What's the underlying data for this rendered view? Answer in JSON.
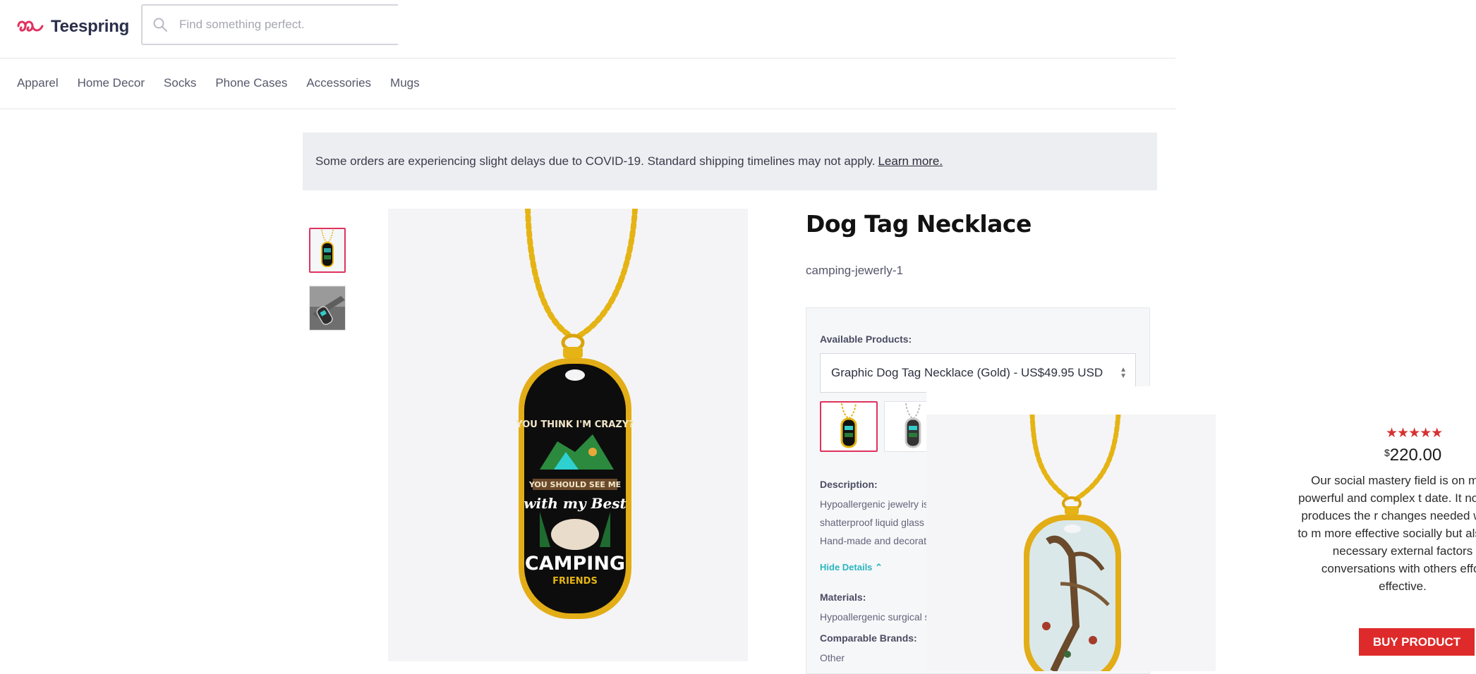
{
  "header": {
    "brand": "Teespring",
    "search": {
      "placeholder": "Find something perfect.",
      "value": ""
    }
  },
  "nav": {
    "items": [
      "Apparel",
      "Home Decor",
      "Socks",
      "Phone Cases",
      "Accessories",
      "Mugs"
    ]
  },
  "notice": {
    "text": "Some orders are experiencing slight delays due to COVID-19. Standard shipping timelines may not apply.",
    "link": "Learn more."
  },
  "product": {
    "title": "Dog Tag Necklace",
    "slug": "camping-jewerly-1",
    "available_label": "Available Products:",
    "selected_product": "Graphic Dog Tag Necklace (Gold) - US$49.95 USD",
    "description_label": "Description:",
    "description_lines": [
      "Hypoallergenic jewelry is r",
      "shatterproof liquid glass c",
      "Hand-made and decorat"
    ],
    "hide_details": "Hide Details",
    "materials_label": "Materials:",
    "materials_text": "Hypoallergenic surgical st",
    "brands_label": "Comparable Brands:",
    "brands_text": "Other",
    "tag_art_text": {
      "line1": "YOU THINK I'M CRAZY?",
      "line2": "YOU SHOULD SEE ME",
      "line3": "with my Best",
      "line4": "CAMPING",
      "line5": "FRIENDS"
    }
  },
  "side_offer": {
    "rating": "★★★★★",
    "currency": "$",
    "price": "220.00",
    "copy": "Our social mastery field is on most powerful and complex t date. It not only produces the r changes needed within to m more effective socially but also the necessary external factors conversations with others effor effective.",
    "button": "BUY PRODUCT"
  },
  "colors": {
    "accent": "#e0325f",
    "buy_button": "#de2a2a",
    "stars": "#d63232",
    "link_teal": "#2bb6c0",
    "gold": "#e5b414"
  }
}
